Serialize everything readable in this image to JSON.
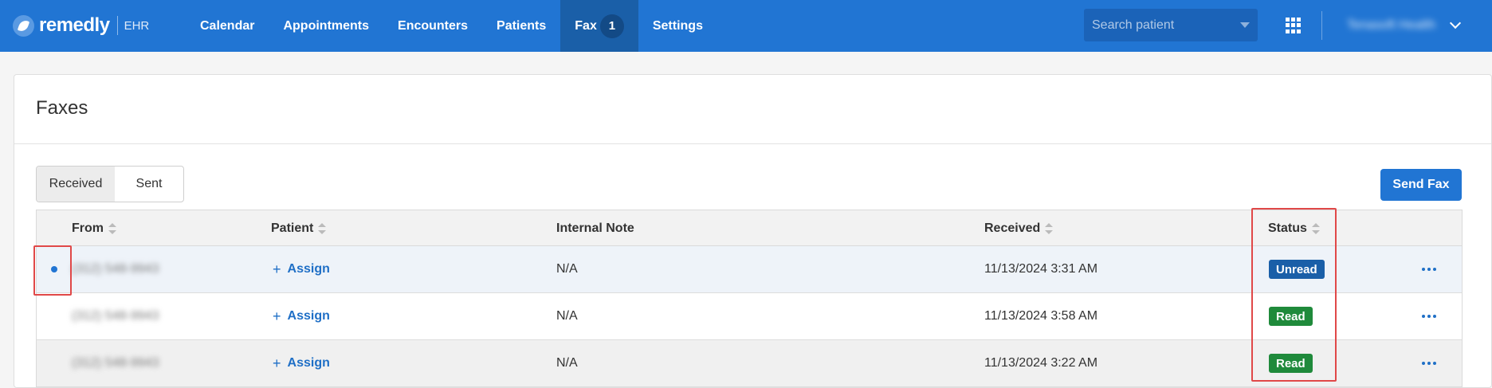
{
  "brand": {
    "name": "remedly",
    "sub": "EHR"
  },
  "nav": {
    "items": [
      {
        "label": "Calendar"
      },
      {
        "label": "Appointments"
      },
      {
        "label": "Encounters"
      },
      {
        "label": "Patients"
      },
      {
        "label": "Fax",
        "badge": "1",
        "active": true
      },
      {
        "label": "Settings"
      }
    ]
  },
  "search": {
    "placeholder": "Search patient"
  },
  "account": {
    "name": "Tenasoft Health"
  },
  "page": {
    "title": "Faxes"
  },
  "tabs": {
    "received": "Received",
    "sent": "Sent",
    "active": "received"
  },
  "actions": {
    "send_fax": "Send Fax"
  },
  "table": {
    "columns": {
      "from": "From",
      "patient": "Patient",
      "note": "Internal Note",
      "received": "Received",
      "status": "Status"
    },
    "rows": [
      {
        "from": "(312) 548-9943",
        "patient": "Assign",
        "note": "N/A",
        "received": "11/13/2024 3:31 AM",
        "status": "Unread",
        "unread": true
      },
      {
        "from": "(312) 548-9943",
        "patient": "Assign",
        "note": "N/A",
        "received": "11/13/2024 3:58 AM",
        "status": "Read",
        "unread": false
      },
      {
        "from": "(312) 548-9943",
        "patient": "Assign",
        "note": "N/A",
        "received": "11/13/2024 3:22 AM",
        "status": "Read",
        "unread": false
      }
    ]
  },
  "colors": {
    "nav_bg": "#2175d3",
    "status_unread": "#1a5fa8",
    "status_read": "#1f8a3b",
    "highlight": "#e04848"
  },
  "icons": {
    "apps": "grid-icon",
    "account_menu": "chevron-down-icon",
    "more": "more-horizontal-icon",
    "unread": "unread-dot-icon",
    "assign": "plus-icon"
  }
}
